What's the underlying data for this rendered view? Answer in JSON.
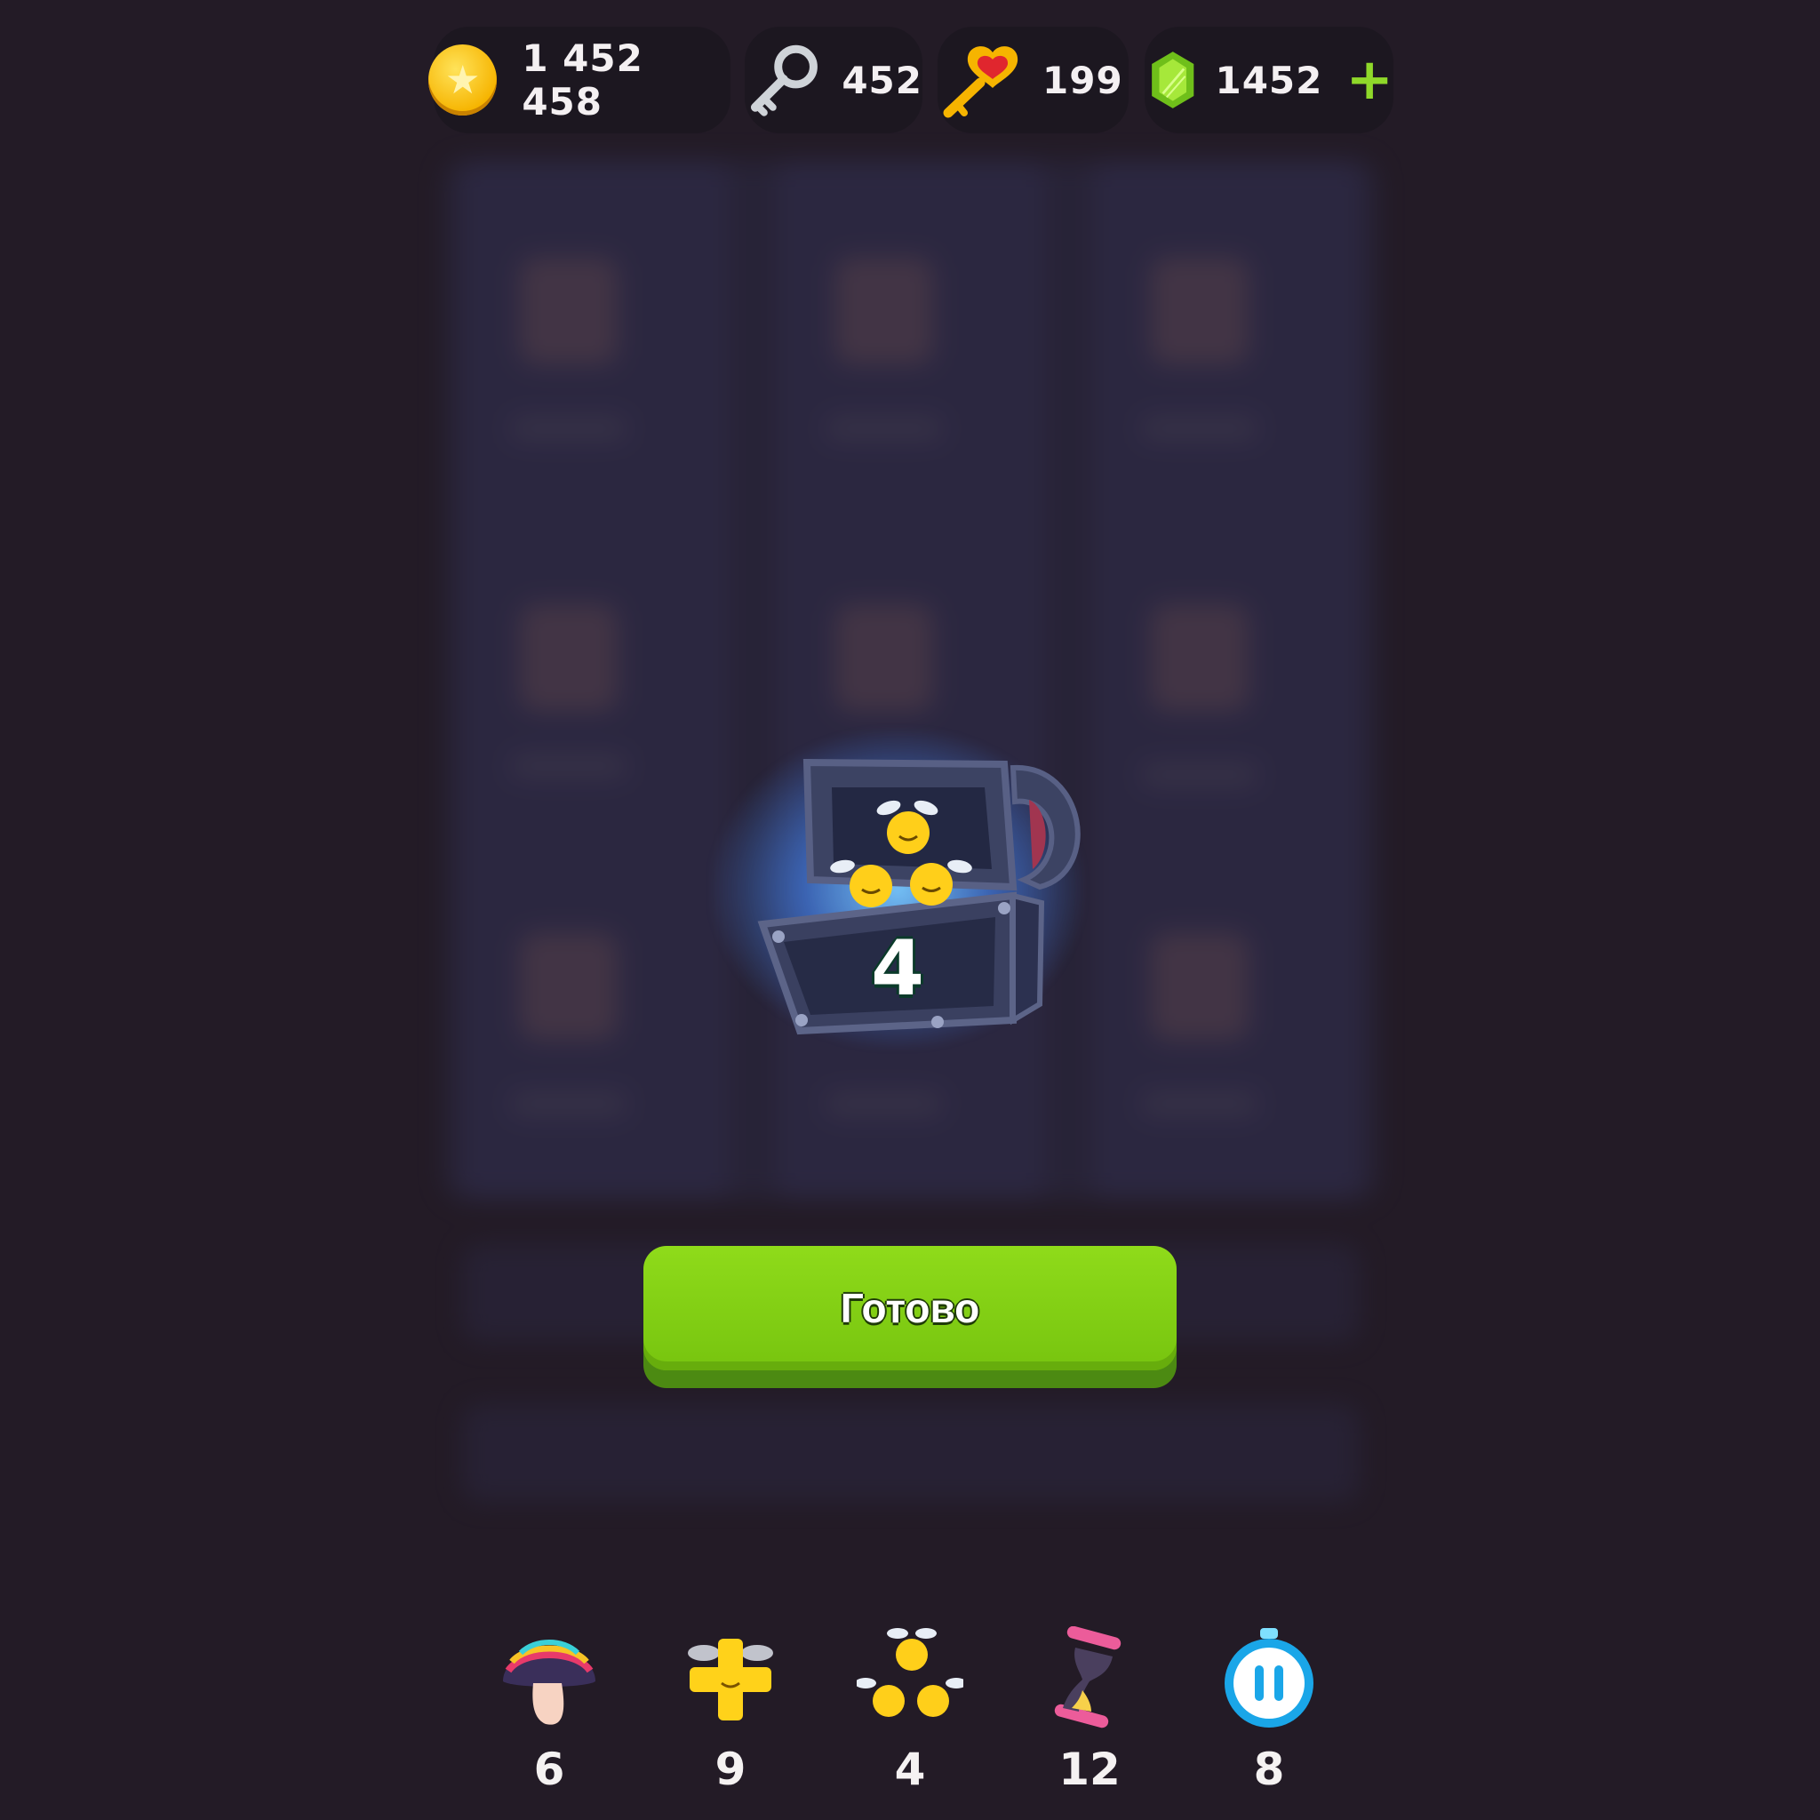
{
  "currencies": {
    "coins": {
      "value": "1 452 458",
      "icon": "star-coin-icon"
    },
    "silver_keys": {
      "value": "452",
      "icon": "silver-key-icon"
    },
    "heart_keys": {
      "value": "199",
      "icon": "heart-key-icon"
    },
    "gems": {
      "value": "1452",
      "icon": "green-gem-icon",
      "add_label": "+"
    }
  },
  "reward": {
    "item": "fireflies-booster-icon",
    "count": "4",
    "chest_icon": "open-chest-icon"
  },
  "done_button": {
    "label": "Готово"
  },
  "boosters": [
    {
      "icon": "rainbow-mushroom-icon",
      "count": "6"
    },
    {
      "icon": "golden-plus-icon",
      "count": "9"
    },
    {
      "icon": "fireflies-icon",
      "count": "4"
    },
    {
      "icon": "hourglass-icon",
      "count": "12"
    },
    {
      "icon": "pause-timer-icon",
      "count": "8"
    }
  ],
  "colors": {
    "background": "#231b26",
    "button_green": "#7fce12",
    "gem_green": "#8fd82a",
    "glow_blue": "#6ab8ff"
  }
}
